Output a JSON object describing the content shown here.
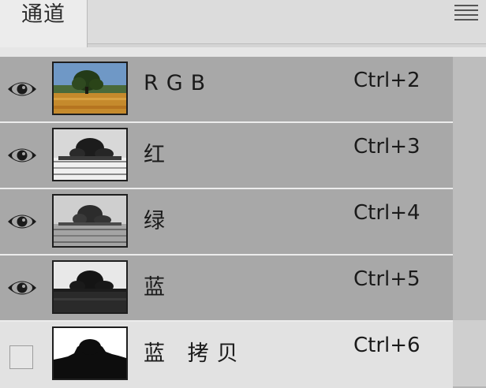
{
  "panel": {
    "tab_label": "通道",
    "menu_icon": "panel-menu-icon"
  },
  "channels": [
    {
      "name": "RGB",
      "shortcut": "Ctrl+2",
      "visible": true,
      "thumbnail": "color"
    },
    {
      "name": "红",
      "shortcut": "Ctrl+3",
      "visible": true,
      "thumbnail": "grayscale-light"
    },
    {
      "name": "绿",
      "shortcut": "Ctrl+4",
      "visible": true,
      "thumbnail": "grayscale-mid"
    },
    {
      "name": "蓝",
      "shortcut": "Ctrl+5",
      "visible": true,
      "thumbnail": "grayscale-dark"
    },
    {
      "name": "蓝 拷贝",
      "shortcut": "Ctrl+6",
      "visible": false,
      "thumbnail": "mask"
    }
  ],
  "colors": {
    "selected_row": "#a8a8a8",
    "unselected_row": "#e2e2e2"
  }
}
